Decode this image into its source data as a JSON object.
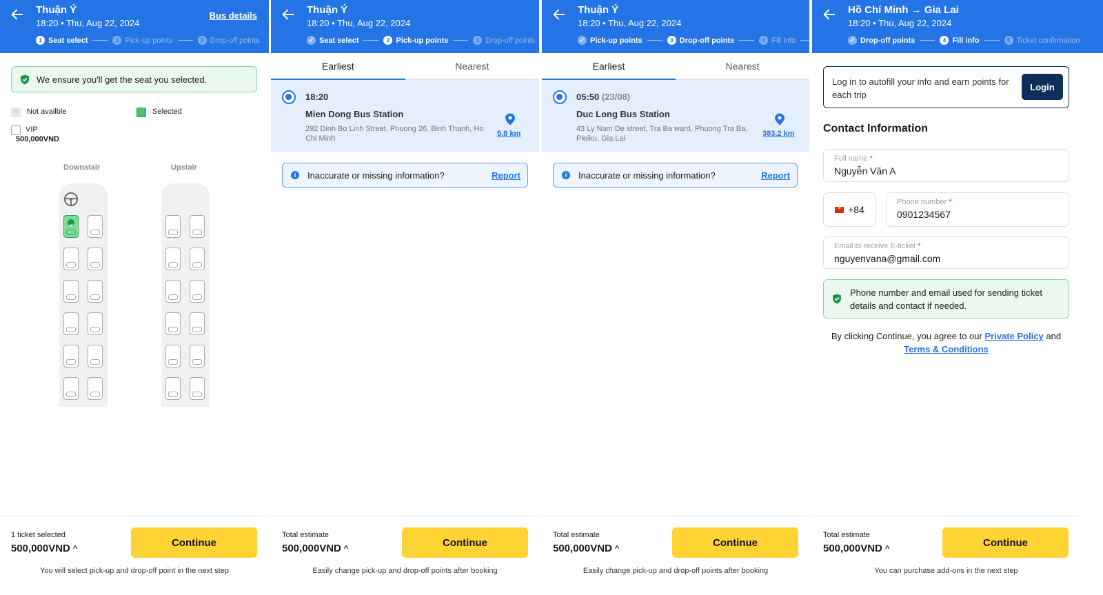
{
  "panels": {
    "seat_select": {
      "header": {
        "title": "Thuận Ý",
        "subtitle": "18:20 • Thu, Aug 22, 2024",
        "link": "Bus details",
        "steps": [
          {
            "num": "1",
            "label": "Seat select",
            "state": "active"
          },
          {
            "num": "2",
            "label": "Pick-up points",
            "state": "upcoming"
          },
          {
            "num": "3",
            "label": "Drop-off points",
            "state": "upcoming"
          }
        ]
      },
      "guarantee": "We ensure you'll get the seat you selected.",
      "legend": {
        "not_available": "Not availble",
        "selected": "Selected",
        "vip": "VIP",
        "vip_price": "500,000VND"
      },
      "floors": {
        "downstairs": "Downstair",
        "upstairs": "Upstair"
      },
      "seat_map": {
        "downstairs_rows": 6,
        "upstairs_rows": 6,
        "columns": 2,
        "selected_seat": "downstairs row 1 column 1"
      },
      "footer": {
        "label": "1 ticket selected",
        "price": "500,000VND",
        "button": "Continue",
        "note": "You will select pick-up and drop-off point in the next step"
      }
    },
    "pickup": {
      "header": {
        "title": "Thuận Ý",
        "subtitle": "18:20 • Thu, Aug 22, 2024",
        "steps": [
          {
            "num": "✓",
            "label": "Seat select",
            "state": "done"
          },
          {
            "num": "2",
            "label": "Pick-up points",
            "state": "active"
          },
          {
            "num": "3",
            "label": "Drop-off points",
            "state": "upcoming"
          }
        ]
      },
      "tabs": [
        "Earliest",
        "Nearest"
      ],
      "option": {
        "time": "18:20",
        "time_extra": "",
        "name": "Mien Dong Bus Station",
        "address": "292 Dinh Bo Linh Street, Phuong 26, Binh Thanh, Ho Chi Minh",
        "distance": "5.8 km"
      },
      "report_prompt": "Inaccurate or missing information?",
      "report_link": "Report",
      "footer": {
        "label": "Total estimate",
        "price": "500,000VND",
        "button": "Continue",
        "note": "Easily change pick-up and drop-off points after booking"
      }
    },
    "dropoff": {
      "header": {
        "title": "Thuận Ý",
        "subtitle": "18:20 • Thu, Aug 22, 2024",
        "steps": [
          {
            "num": "✓",
            "label": "Pick-up points",
            "state": "done"
          },
          {
            "num": "3",
            "label": "Drop-off points",
            "state": "active"
          },
          {
            "num": "4",
            "label": "Fill info",
            "state": "upcoming"
          }
        ]
      },
      "tabs": [
        "Earliest",
        "Nearest"
      ],
      "option": {
        "time": "05:50",
        "time_extra": "(23/08)",
        "name": "Duc Long Bus Station",
        "address": "43 Ly Nam De street, Tra Ba ward, Phuong Tra Ba, Pleiku, Gia Lai",
        "distance": "383.2 km"
      },
      "report_prompt": "Inaccurate or missing information?",
      "report_link": "Report",
      "footer": {
        "label": "Total estimate",
        "price": "500,000VND",
        "button": "Continue",
        "note": "Easily change pick-up and drop-off points after booking"
      }
    },
    "fill_info": {
      "header": {
        "title": "Hồ Chí Minh → Gia Lai",
        "subtitle": "18:20 • Thu, Aug 22, 2024",
        "steps": [
          {
            "num": "✓",
            "label": "Drop-off points",
            "state": "done"
          },
          {
            "num": "4",
            "label": "Fill info",
            "state": "active"
          },
          {
            "num": "5",
            "label": "Ticket confirmation",
            "state": "upcoming"
          }
        ]
      },
      "login_prompt": "Log in to autofill your info and earn points for each trip",
      "login_button": "Login",
      "section_title": "Contact Information",
      "fields": {
        "full_name": {
          "label": "Full name",
          "value": "Nguyễn Văn A"
        },
        "country_code": "+84",
        "phone": {
          "label": "Phone number",
          "value": "0901234567"
        },
        "email": {
          "label": "Email to receive E-ticket",
          "value": "nguyenvana@gmail.com"
        }
      },
      "required_mark": "*",
      "privacy_note": "Phone number and email used for sending ticket details and contact if needed.",
      "agree_prefix": "By clicking Continue, you agree to our",
      "privacy_link": "Private Policy",
      "agree_and": "and",
      "terms_link": "Terms & Conditions",
      "footer": {
        "label": "Total estimate",
        "price": "500,000VND",
        "button": "Continue",
        "note": "You can purchase add-ons in the next step"
      }
    }
  },
  "colors": {
    "brand_blue": "#2474e5",
    "continue_yellow": "#ffd333",
    "success_green": "#2fa756",
    "login_navy": "#0d2e59"
  }
}
